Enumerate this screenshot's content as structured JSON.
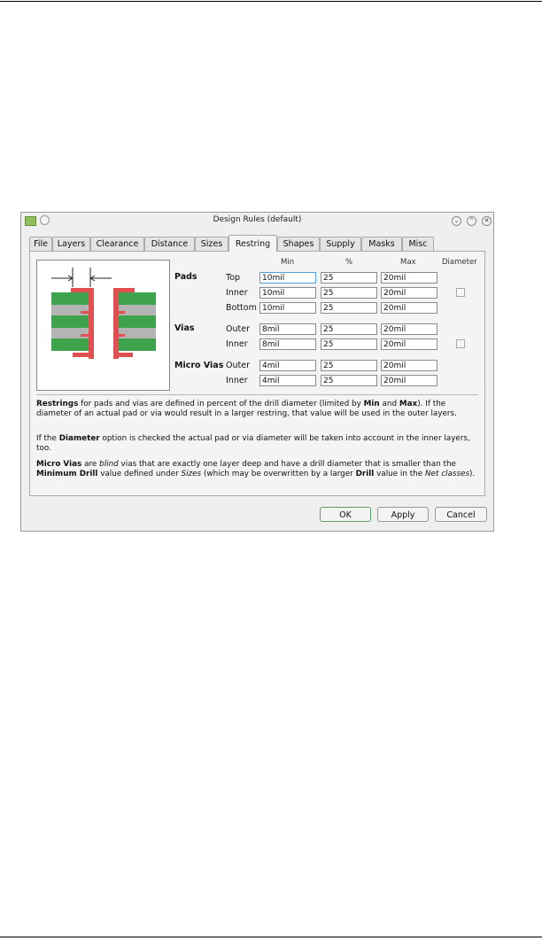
{
  "window": {
    "title": "Design Rules (default)"
  },
  "tabs": [
    "File",
    "Layers",
    "Clearance",
    "Distance",
    "Sizes",
    "Restring",
    "Shapes",
    "Supply",
    "Masks",
    "Misc"
  ],
  "active_tab": "Restring",
  "columns": {
    "min": "Min",
    "percent": "%",
    "max": "Max",
    "diameter": "Diameter"
  },
  "sections": {
    "pads": "Pads",
    "vias": "Vias",
    "micro_vias": "Micro Vias"
  },
  "rows": {
    "pads_top": {
      "label": "Top",
      "min": "10mil",
      "percent": "25",
      "max": "20mil"
    },
    "pads_inner": {
      "label": "Inner",
      "min": "10mil",
      "percent": "25",
      "max": "20mil",
      "diameter_checked": false
    },
    "pads_bottom": {
      "label": "Bottom",
      "min": "10mil",
      "percent": "25",
      "max": "20mil"
    },
    "vias_outer": {
      "label": "Outer",
      "min": "8mil",
      "percent": "25",
      "max": "20mil"
    },
    "vias_inner": {
      "label": "Inner",
      "min": "8mil",
      "percent": "25",
      "max": "20mil",
      "diameter_checked": false
    },
    "micro_outer": {
      "label": "Outer",
      "min": "4mil",
      "percent": "25",
      "max": "20mil"
    },
    "micro_inner": {
      "label": "Inner",
      "min": "4mil",
      "percent": "25",
      "max": "20mil"
    }
  },
  "help": {
    "p1": {
      "a": "Restrings",
      "b": " for pads and vias are defined in percent of the drill diameter (limited by ",
      "c": "Min",
      "d": " and ",
      "e": "Max",
      "f": "). If the diameter of an actual pad or via would result in a larger restring, that value will be used in the outer layers."
    },
    "p2": {
      "a": "If the ",
      "b": "Diameter",
      "c": " option is checked the actual pad or via diameter will be taken into account in the inner layers, too."
    },
    "p3": {
      "a": "Micro Vias",
      "b": " are ",
      "c": "blind",
      "d": " vias that are exactly one layer deep and have a drill diameter that is smaller than the ",
      "e": "Minimum Drill",
      "f": " value defined under ",
      "g": "Sizes",
      "h": " (which may be overwritten by a larger ",
      "i": "Drill",
      "j": " value in the ",
      "k": "Net classes",
      "l": ")."
    }
  },
  "buttons": {
    "ok": "OK",
    "apply": "Apply",
    "cancel": "Cancel"
  },
  "colors": {
    "copper": "#3fa34d",
    "substrate": "#b4b4b4",
    "restring": "#e05050"
  }
}
